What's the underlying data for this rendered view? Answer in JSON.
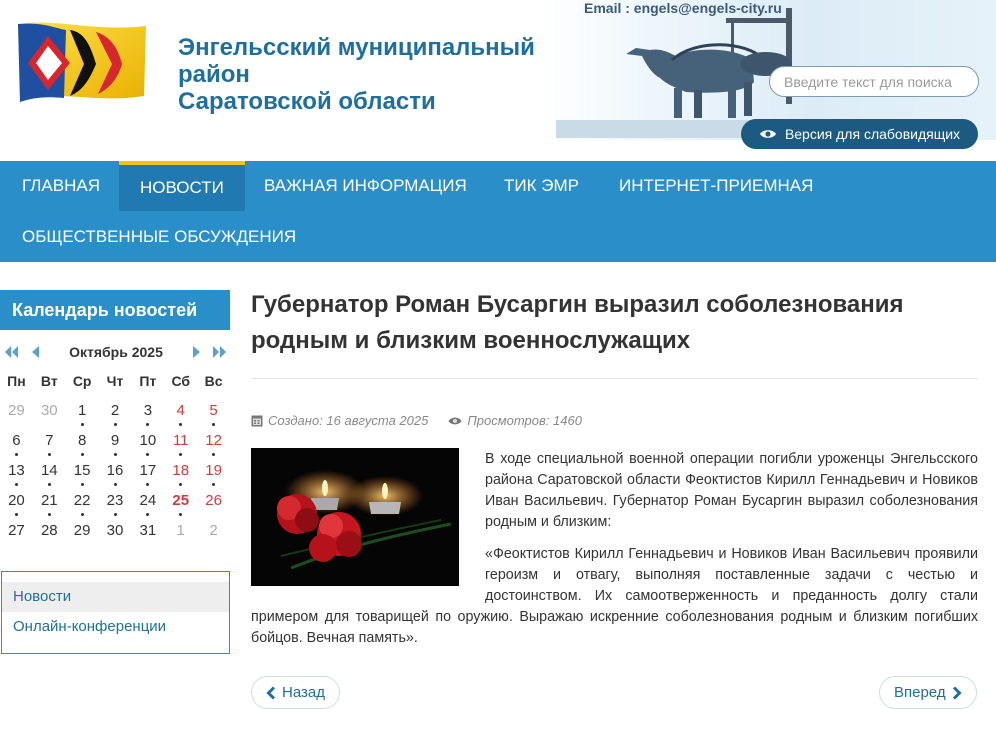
{
  "header": {
    "email": "Email : engels@engels-city.ru",
    "title_lines": [
      "Энгельсский муниципальный",
      "район",
      "Саратовской области"
    ],
    "search_placeholder": "Введите текст для поиска",
    "accessibility_label": "Версия для слабовидящих"
  },
  "nav": {
    "items": [
      "ГЛАВНАЯ",
      "НОВОСТИ",
      "ВАЖНАЯ ИНФОРМАЦИЯ",
      "ТИК ЭМР",
      "ИНТЕРНЕТ-ПРИЕМНАЯ",
      "ОБЩЕСТВЕННЫЕ ОБСУЖДЕНИЯ"
    ],
    "active": "НОВОСТИ"
  },
  "calendar": {
    "title": "Календарь новостей",
    "month": "Октябрь 2025",
    "weekdays": [
      "Пн",
      "Вт",
      "Ср",
      "Чт",
      "Пт",
      "Сб",
      "Вс"
    ],
    "weeks": [
      [
        "29",
        "30",
        "1",
        "2",
        "3",
        "4",
        "5"
      ],
      [
        "6",
        "7",
        "8",
        "9",
        "10",
        "11",
        "12"
      ],
      [
        "13",
        "14",
        "15",
        "16",
        "17",
        "18",
        "19"
      ],
      [
        "20",
        "21",
        "22",
        "23",
        "24",
        "25",
        "26"
      ],
      [
        "27",
        "28",
        "29",
        "30",
        "31",
        "1",
        "2"
      ]
    ],
    "today": "25"
  },
  "side_menu": {
    "items": [
      "Новости",
      "Онлайн-конференции"
    ],
    "active": "Новости"
  },
  "article": {
    "title": "Губернатор Роман Бусаргин выразил соболезнования родным и близким военнослужащих",
    "created": "Создано: 16 августа 2025",
    "views": "Просмотров: 1460",
    "paragraph1": "В ходе специальной военной операции погибли уроженцы Энгельсского района Саратовской области Феоктистов Кирилл Геннадьевич и Новиков Иван Васильевич. Губернатор Роман Бусаргин выразил соболезнования родным и близким:",
    "paragraph2": "«Феоктистов Кирилл Геннадьевич  и Новиков Иван Васильевич проявили героизм и отвагу, выполняя поставленные задачи с честью и достоинством. Их самоотверженность и преданность долгу стали примером для товарищей по оружию. Выражаю искренние соболезнования родным и близким погибших бойцов. Вечная память»."
  },
  "pager": {
    "prev": "Назад",
    "next": "Вперед"
  },
  "colors": {
    "nav_bg": "#2a8fc8",
    "nav_active": "#2179b2",
    "nav_accent": "#f0c419",
    "title_blue": "#1e6f9f",
    "weekend_red": "#d9383a"
  }
}
